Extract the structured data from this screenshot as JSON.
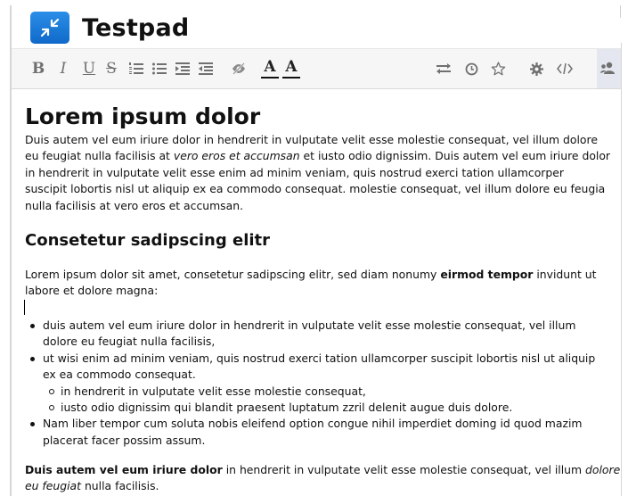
{
  "app": {
    "title": "Testpad"
  },
  "toolbar": {
    "bold": "B",
    "italic": "I",
    "underline": "U",
    "strike": "S",
    "font_color": "A",
    "highlight": "A"
  },
  "colors": {
    "accent": "#1a7fe0",
    "toolbar_bg": "#f6f6f6",
    "icon": "#707070"
  },
  "document": {
    "heading1": "Lorem ipsum dolor",
    "p1_lines": [
      "Duis autem vel eum iriure dolor in hendrerit in vulputate velit esse molestie consequat, vel illum dolore",
      [
        "eu feugiat nulla facilisis at ",
        "vero eros et accumsan",
        " et iusto odio dignissim. Duis autem vel eum iriure dolor"
      ],
      "in hendrerit in vulputate velit esse enim ad minim veniam, quis nostrud exerci tation ullamcorper",
      "suscipit lobortis nisl ut aliquip ex ea commodo consequat. molestie consequat, vel illum dolore eu feugia",
      "nulla facilisis at vero eros et accumsan."
    ],
    "heading2": "Consetetur sadipscing elitr",
    "p2_line1_a": "Lorem ipsum dolor sit amet, consetetur sadipscing elitr, sed diam nonumy ",
    "p2_line1_bold": "eirmod tempor",
    "p2_line1_b": " invidunt ut",
    "p2_line2": "labore et dolore magna:",
    "list": {
      "item1_l1": "duis autem vel eum iriure dolor in hendrerit in vulputate velit esse molestie consequat, vel illum",
      "item1_l2": "dolore eu feugiat nulla facilisis,",
      "item2_l1": "ut wisi enim ad minim veniam, quis nostrud exerci tation ullamcorper suscipit lobortis nisl ut aliquip",
      "item2_l2": "ex ea commodo consequat.",
      "sub1": "in hendrerit in vulputate velit esse molestie consequat,",
      "sub2": "iusto odio dignissim qui blandit praesent luptatum zzril delenit augue duis dolore.",
      "item3_l1": "Nam liber tempor cum soluta nobis eleifend option congue nihil imperdiet doming id quod mazim",
      "item3_l2": "placerat facer possim assum."
    },
    "p3_bold": "Duis autem vel eum iriure dolor",
    "p3_a": " in hendrerit in vulputate velit esse molestie consequat, vel illum ",
    "p3_italic1": "dolore",
    "p3_italic2": "eu feugiat",
    "p3_b": " nulla facilisis."
  }
}
